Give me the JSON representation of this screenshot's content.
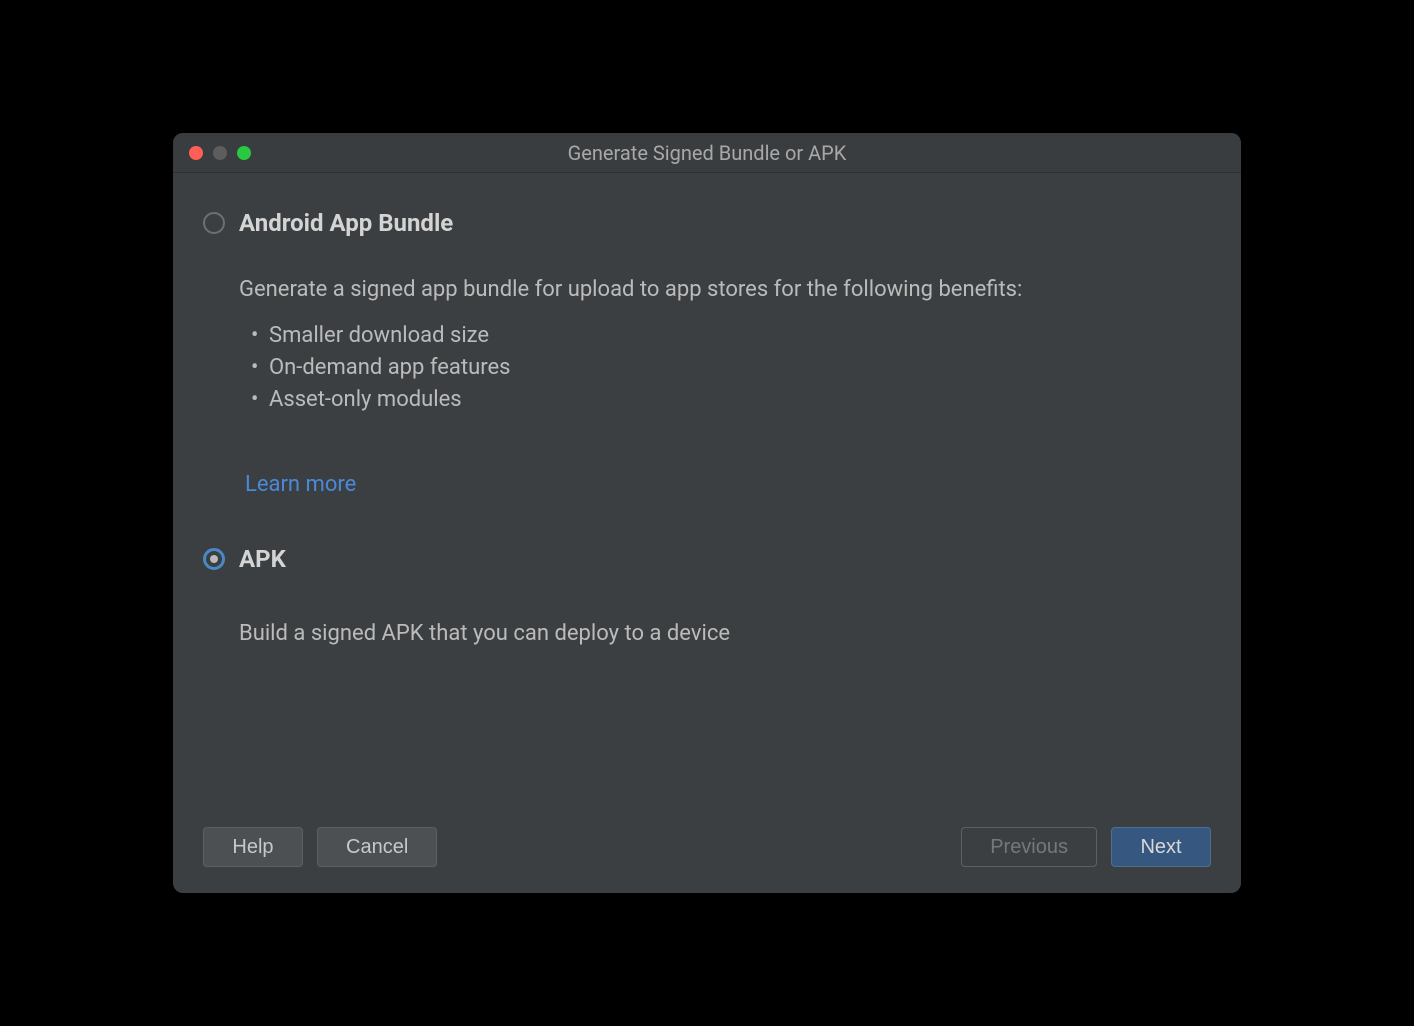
{
  "dialog": {
    "title": "Generate Signed Bundle or APK"
  },
  "options": {
    "bundle": {
      "label": "Android App Bundle",
      "intro": "Generate a signed app bundle for upload to app stores for the following benefits:",
      "benefits": [
        "Smaller download size",
        "On-demand app features",
        "Asset-only modules"
      ],
      "learn_more": "Learn more",
      "selected": false
    },
    "apk": {
      "label": "APK",
      "description": "Build a signed APK that you can deploy to a device",
      "selected": true
    }
  },
  "buttons": {
    "help": "Help",
    "cancel": "Cancel",
    "previous": "Previous",
    "next": "Next"
  }
}
